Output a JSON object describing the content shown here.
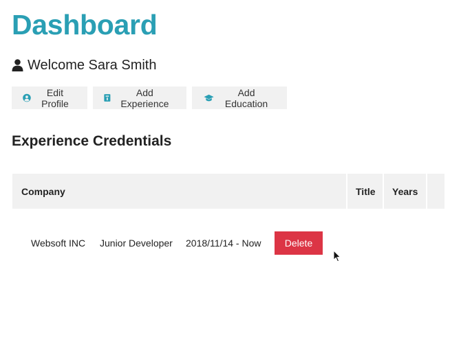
{
  "header": {
    "title": "Dashboard",
    "welcome": "Welcome Sara Smith"
  },
  "actions": [
    {
      "label": "Edit Profile",
      "icon": "user-circle-icon"
    },
    {
      "label": "Add Experience",
      "icon": "id-badge-icon"
    },
    {
      "label": "Add Education",
      "icon": "graduation-cap-icon"
    }
  ],
  "experience": {
    "title": "Experience Credentials",
    "columns": [
      "Company",
      "Title",
      "Years"
    ],
    "rows": [
      {
        "company": "Websoft INC",
        "title": "Junior Developer",
        "years": "2018/11/14 - Now",
        "action": "Delete"
      }
    ]
  },
  "colors": {
    "brand": "#2a9fb4",
    "danger": "#dc3545",
    "button_bg": "#f1f1f1"
  }
}
